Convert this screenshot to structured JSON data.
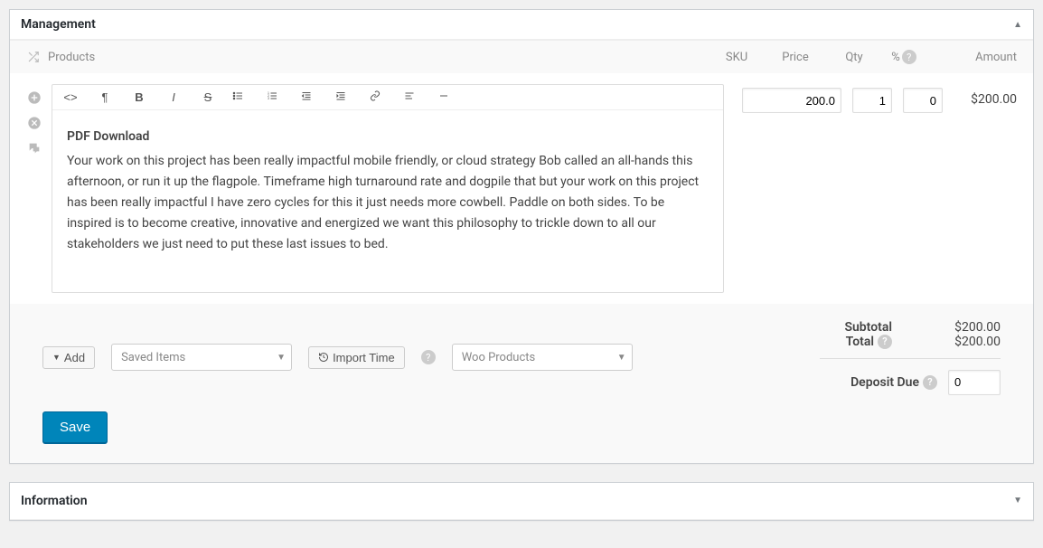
{
  "panels": {
    "management": {
      "title": "Management",
      "collapsed": false
    },
    "information": {
      "title": "Information",
      "collapsed": true
    }
  },
  "columns": {
    "products": "Products",
    "sku": "SKU",
    "price": "Price",
    "qty": "Qty",
    "pct": "%",
    "amount": "Amount"
  },
  "line_item": {
    "title": "PDF Download",
    "description": "Your work on this project has been really impactful mobile friendly, or cloud strategy Bob called an all-hands this afternoon, or run it up the flagpole. Timeframe high turnaround rate and dogpile that but your work on this project has been really impactful I have zero cycles for this it just needs more cowbell. Paddle on both sides. To be inspired is to become creative, innovative and energized we want this philosophy to trickle down to all our stakeholders we just need to put these last issues to bed.",
    "price": "200.0",
    "qty": "1",
    "pct": "0",
    "amount": "$200.00"
  },
  "footer": {
    "add_label": "Add",
    "saved_items_placeholder": "Saved Items",
    "import_time_label": "Import Time",
    "woo_placeholder": "Woo Products",
    "save_label": "Save"
  },
  "totals": {
    "subtotal_label": "Subtotal",
    "subtotal_value": "$200.00",
    "total_label": "Total",
    "total_value": "$200.00",
    "deposit_label": "Deposit Due",
    "deposit_value": "0"
  }
}
